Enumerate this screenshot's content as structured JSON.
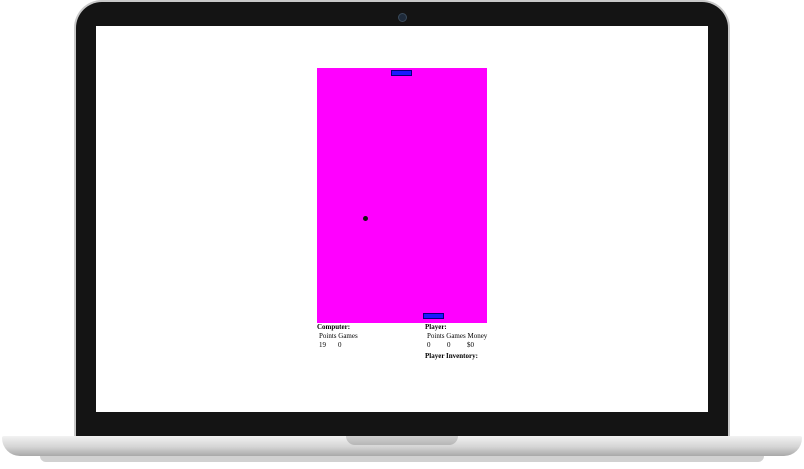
{
  "computer": {
    "heading": "Computer:",
    "headers": [
      "Points",
      "Games"
    ],
    "values": [
      "19",
      "0"
    ]
  },
  "player": {
    "heading": "Player:",
    "headers": [
      "Points",
      "Games",
      "Money"
    ],
    "values": [
      "0",
      "0",
      "$0"
    ],
    "inventory_heading": "Player Inventory:"
  },
  "colors": {
    "field": "#ff00ff",
    "paddle": "#1a1aff",
    "ball": "#111111"
  }
}
